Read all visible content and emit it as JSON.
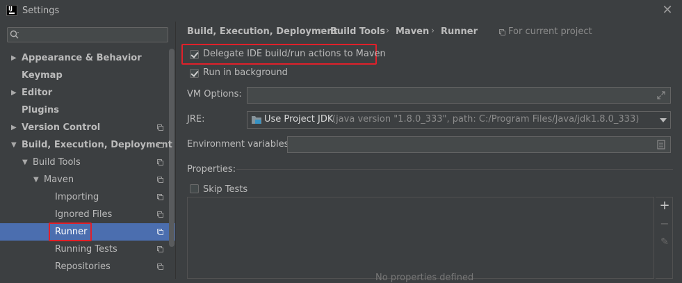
{
  "window": {
    "title": "Settings",
    "app_icon_label": "IJ"
  },
  "sidebar": {
    "search_placeholder": "",
    "items": [
      {
        "label": "Appearance & Behavior"
      },
      {
        "label": "Keymap"
      },
      {
        "label": "Editor"
      },
      {
        "label": "Plugins"
      },
      {
        "label": "Version Control"
      },
      {
        "label": "Build, Execution, Deployment"
      },
      {
        "label": "Build Tools"
      },
      {
        "label": "Maven"
      },
      {
        "label": "Importing"
      },
      {
        "label": "Ignored Files"
      },
      {
        "label": "Runner"
      },
      {
        "label": "Running Tests"
      },
      {
        "label": "Repositories"
      }
    ]
  },
  "breadcrumb": {
    "items": [
      "Build, Execution, Deployment",
      "Build Tools",
      "Maven",
      "Runner"
    ],
    "separator": "›",
    "scope": "For current project"
  },
  "form": {
    "delegate_label": "Delegate IDE build/run actions to Maven",
    "delegate_checked": true,
    "background_label": "Run in background",
    "background_checked": true,
    "vm_options_label": "VM Options:",
    "vm_options_value": "",
    "jre_label": "JRE:",
    "jre_value": "Use Project JDK",
    "jre_detail": "(java version \"1.8.0_333\", path: C:/Program Files/Java/jdk1.8.0_333)",
    "env_label": "Environment variables:",
    "env_value": "",
    "properties_label": "Properties:",
    "skip_tests_label": "Skip Tests",
    "skip_tests_checked": false,
    "empty_text": "No properties defined"
  },
  "toolbar": {
    "add": "+",
    "remove": "−",
    "edit": "✎"
  },
  "colors": {
    "background": "#3c3f41",
    "selection": "#4b6eaf",
    "highlight": "#e0202a"
  }
}
